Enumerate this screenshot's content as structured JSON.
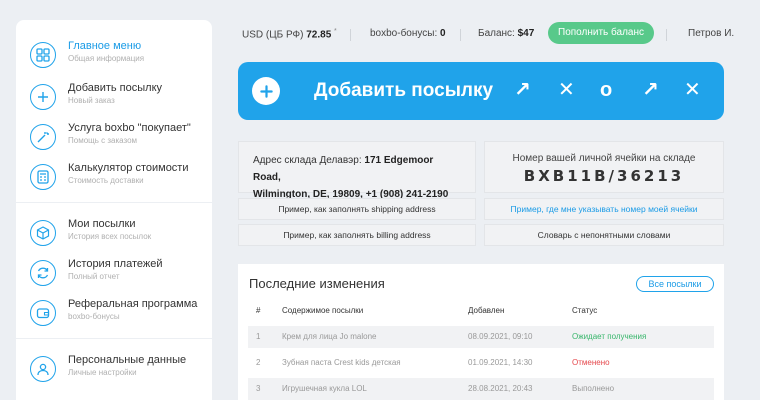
{
  "sidebar": {
    "items": [
      {
        "title": "Главное меню",
        "sub": "Общая информация",
        "icon": "grid-icon"
      },
      {
        "title": "Добавить посылку",
        "sub": "Новый заказ",
        "icon": "plus-icon"
      },
      {
        "title": "Услуга boxbo \"покупает\"",
        "sub": "Помощь с заказом",
        "icon": "magic-wand-icon"
      },
      {
        "title": "Калькулятор стоимости",
        "sub": "Стоимость доставки",
        "icon": "calculator-icon"
      },
      {
        "title": "Мои посылки",
        "sub": "История всех посылок",
        "icon": "package-icon"
      },
      {
        "title": "История платежей",
        "sub": "Полный отчет",
        "icon": "refresh-icon"
      },
      {
        "title": "Реферальная программа",
        "sub": "boxbo-бонусы",
        "icon": "wallet-icon"
      },
      {
        "title": "Персональные данные",
        "sub": "Личные настройки",
        "icon": "user-icon"
      }
    ]
  },
  "topbar": {
    "rate_label": "USD (ЦБ РФ)",
    "rate_value": "72.85",
    "rate_mark": "*",
    "bonus_label": "boxbo-бонусы:",
    "bonus_value": "0",
    "balance_label": "Баланс:",
    "balance_value": "$47",
    "topup_label": "Пополнить баланс",
    "user_name": "Петров И."
  },
  "add_parcel": {
    "label": "Добавить посылку",
    "glyphs": [
      "↗",
      "✕",
      "o",
      "↗",
      "✕"
    ]
  },
  "warehouse": {
    "address_prefix": "Адрес склада Делавэр:",
    "address_line1": "171 Edgemoor Road,",
    "address_line2": "Wilmington, DE, 19809, +1 (908) 241-2190",
    "cell_label": "Номер вашей личной ячейки на складе",
    "cell_value": "BXB11B/36213"
  },
  "examples": {
    "shipping": "Пример, как заполнять shipping address",
    "cell_where": "Пример, где мне указывать номер моей ячейки",
    "billing": "Пример, как заполнять billing address",
    "glossary": "Словарь с непонятными словами"
  },
  "recent": {
    "title": "Последние изменения",
    "all_button": "Все посылки",
    "columns": [
      "#",
      "Содержимое посылки",
      "Добавлен",
      "Статус"
    ],
    "rows": [
      {
        "num": "1",
        "content": "Крем для лица Jo malone",
        "date": "08.09.2021, 09:10",
        "status": "Ожидает получения",
        "status_color": "#38b66b"
      },
      {
        "num": "2",
        "content": "Зубная паста Crest kids детская",
        "date": "01.09.2021, 14:30",
        "status": "Отменено",
        "status_color": "#e5484d"
      },
      {
        "num": "3",
        "content": "Игрушечная кукла LOL",
        "date": "28.08.2021, 20:43",
        "status": "Выполнено",
        "status_color": "#999999"
      }
    ]
  },
  "colors": {
    "accent": "#20a3ea",
    "topup": "#58c98a",
    "ok": "#38b66b",
    "cancel": "#e5484d"
  }
}
